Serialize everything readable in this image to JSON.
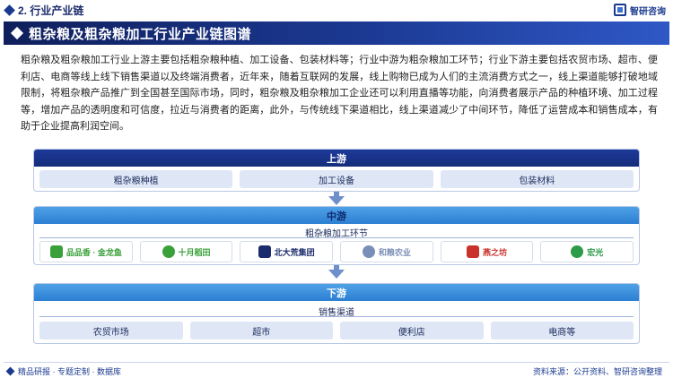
{
  "header": {
    "section": "2. 行业产业链",
    "brand": "智研咨询"
  },
  "title": "粗杂粮及粗杂粮加工行业产业链图谱",
  "paragraph": "粗杂粮及粗杂粮加工行业上游主要包括粗杂粮种植、加工设备、包装材料等；行业中游为粗杂粮加工环节；行业下游主要包括农贸市场、超市、便利店、电商等线上线下销售渠道以及终端消费者，近年来，随着互联网的发展，线上购物已成为人们的主流消费方式之一，线上渠道能够打破地域限制，将粗杂粮产品推广到全国甚至国际市场，同时，粗杂粮及粗杂粮加工企业还可以利用直播等功能，向消费者展示产品的种植环境、加工过程等，增加产品的透明度和可信度，拉近与消费者的距离，此外，与传统线下渠道相比，线上渠道减少了中间环节，降低了运营成本和销售成本，有助于企业提高利润空间。",
  "upstream": {
    "label": "上游",
    "items": [
      "粗杂粮种植",
      "加工设备",
      "包装材料"
    ]
  },
  "midstream": {
    "label": "中游",
    "sublabel": "粗杂粮加工环节",
    "logos": [
      {
        "text": "品品香 · 金龙鱼",
        "color": "#3aa03a"
      },
      {
        "text": "十月稻田",
        "color": "#3aa03a"
      },
      {
        "text": "北大荒集团",
        "color": "#1b2b6b"
      },
      {
        "text": "和粮农业",
        "color": "#7a8fb8"
      },
      {
        "text": "燕之坊",
        "color": "#c8322a"
      },
      {
        "text": "宏光",
        "color": "#2e9a4a"
      }
    ]
  },
  "downstream": {
    "label": "下游",
    "sublabel": "销售渠道",
    "items": [
      "农贸市场",
      "超市",
      "便利店",
      "电商等"
    ]
  },
  "footer": {
    "left": "精品研报 · 专题定制 · 数据库",
    "source": "资料来源：公开资料、智研咨询整理"
  },
  "colors": {
    "navy": "#152c7a",
    "light_blue": "#2c7fd2",
    "box_fill": "#dfe7f6"
  }
}
